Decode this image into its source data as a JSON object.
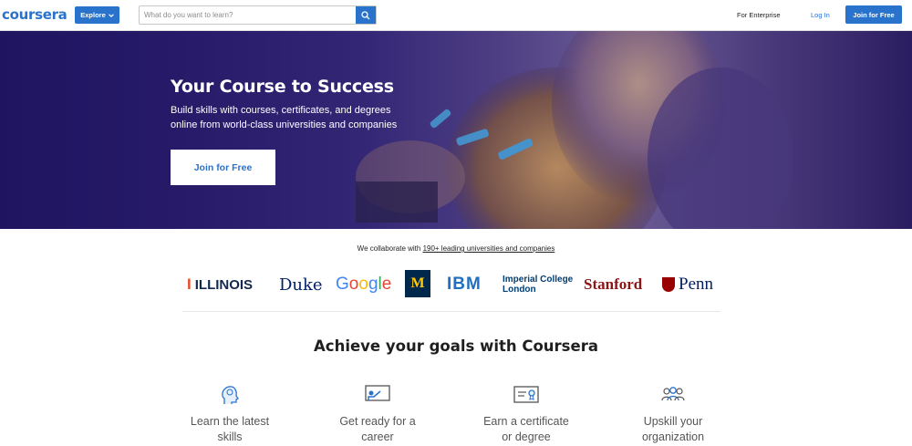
{
  "header": {
    "logo_text": "coursera",
    "explore_label": "Explore",
    "search_placeholder": "What do you want to learn?",
    "for_enterprise": "For Enterprise",
    "login": "Log In",
    "join_free": "Join for Free"
  },
  "hero": {
    "title": "Your Course to Success",
    "subtitle": "Build skills with courses, certificates, and degrees online from world-class universities and companies",
    "cta": "Join for Free"
  },
  "partners": {
    "intro": "We collaborate with ",
    "link": "190+ leading universities and companies",
    "logos": {
      "illinois": "ILLINOIS",
      "duke": "Duke",
      "google": "Google",
      "michigan": "M",
      "ibm": "IBM",
      "imperial_line1": "Imperial College",
      "imperial_line2": "London",
      "stanford": "Stanford",
      "penn": "Penn"
    }
  },
  "goals": {
    "title": "Achieve your goals with Coursera",
    "items": [
      {
        "line1": "Learn the latest",
        "line2": "skills",
        "icon": "brain-head-icon"
      },
      {
        "line1": "Get ready for a",
        "line2": "career",
        "icon": "teacher-board-icon"
      },
      {
        "line1": "Earn a certificate",
        "line2": "or degree",
        "icon": "certificate-icon"
      },
      {
        "line1": "Upskill your",
        "line2": "organization",
        "icon": "group-people-icon"
      }
    ]
  },
  "colors": {
    "brand_blue": "#2a73cc",
    "hero_purple": "#2d1f70"
  }
}
